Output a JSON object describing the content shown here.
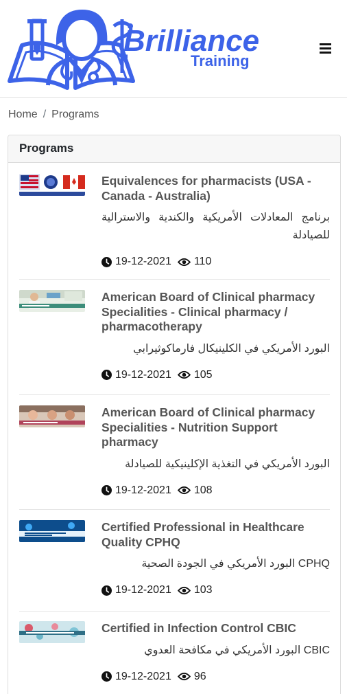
{
  "header": {
    "brand": {
      "line1": "Brilliance",
      "line2": "Training"
    },
    "menu_icon": "hamburger-icon"
  },
  "breadcrumb": {
    "home": "Home",
    "separator": "/",
    "current": "Programs"
  },
  "card": {
    "title": "Programs"
  },
  "programs": [
    {
      "title": "Equivalences for pharmacists (USA - Canada - Australia)",
      "subtitle": "برنامج المعادلات الأمريكية والكندية والاسترالية للصيادلة",
      "date": "19-12-2021",
      "views": "110"
    },
    {
      "title": "American Board of Clinical pharmacy Specialities - Clinical pharmacy / pharmacotherapy",
      "subtitle": "البورد الأمريكي في الكلينيكال فارماكوثيرابي",
      "date": "19-12-2021",
      "views": "105"
    },
    {
      "title": "American Board of Clinical pharmacy Specialities - Nutrition Support pharmacy",
      "subtitle": "البورد الأمريكي في التغذية الإكلينيكية للصيادلة",
      "date": "19-12-2021",
      "views": "108"
    },
    {
      "title": "Certified Professional in Healthcare Quality CPHQ",
      "subtitle": "CPHQ البورد الأمريكي في الجودة الصحية",
      "date": "19-12-2021",
      "views": "103"
    },
    {
      "title": "Certified in Infection Control CBIC",
      "subtitle": "CBIC البورد الأمريكي في مكافحة العدوي",
      "date": "19-12-2021",
      "views": "96"
    }
  ],
  "icons": {
    "clock": "clock-icon",
    "views": "eye-icon"
  },
  "colors": {
    "brand_blue": "#3d63e8",
    "header_bg": "#f7f7f7",
    "text_title": "#555555"
  }
}
